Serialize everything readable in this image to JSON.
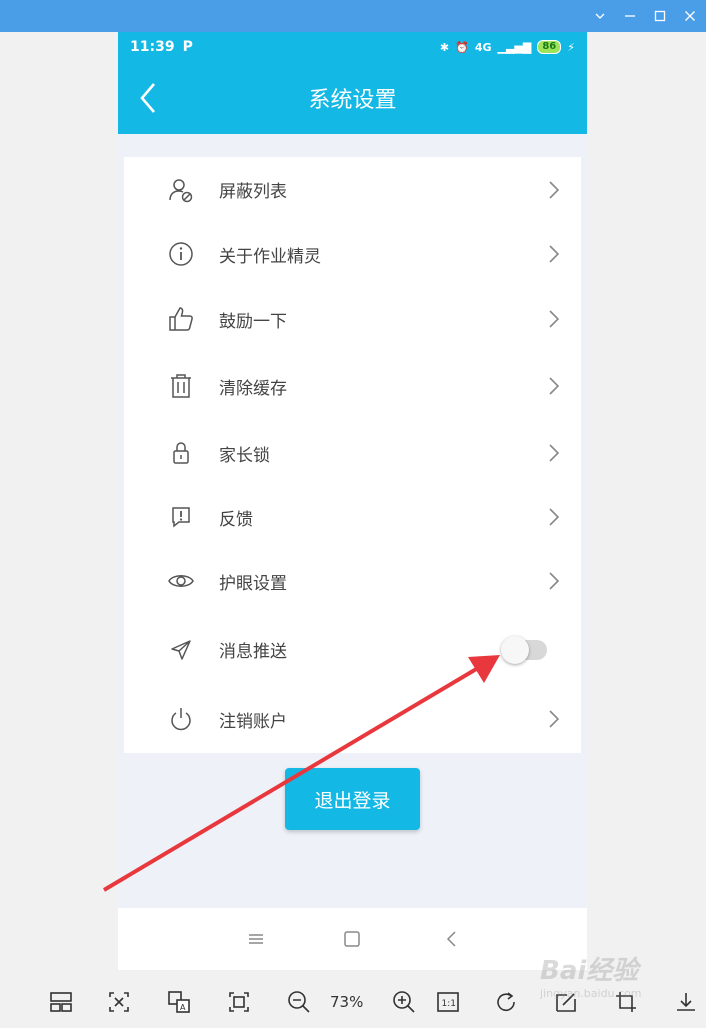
{
  "status": {
    "time": "11:39",
    "p_icon": "P",
    "network": "4G",
    "battery": "86"
  },
  "header": {
    "title": "系统设置"
  },
  "settings": [
    {
      "icon": "person-blocked-icon",
      "label": "屏蔽列表"
    },
    {
      "icon": "info-icon",
      "label": "关于作业精灵"
    },
    {
      "icon": "thumbs-up-icon",
      "label": "鼓励一下"
    },
    {
      "icon": "trash-icon",
      "label": "清除缓存"
    },
    {
      "icon": "lock-icon",
      "label": "家长锁"
    },
    {
      "icon": "feedback-icon",
      "label": "反馈"
    },
    {
      "icon": "eye-icon",
      "label": "护眼设置"
    },
    {
      "icon": "send-icon",
      "label": "消息推送",
      "toggle": false
    },
    {
      "icon": "power-icon",
      "label": "注销账户"
    }
  ],
  "logout_label": "退出登录",
  "toolbar": {
    "zoom": "73%",
    "one_to_one": "1:1"
  },
  "watermark": {
    "text": "Bai经验",
    "sub": "jingyan.baidu.com"
  },
  "colors": {
    "accent": "#14b8e5",
    "window_title": "#4a9ee8",
    "annotation_arrow": "#e8383d"
  }
}
